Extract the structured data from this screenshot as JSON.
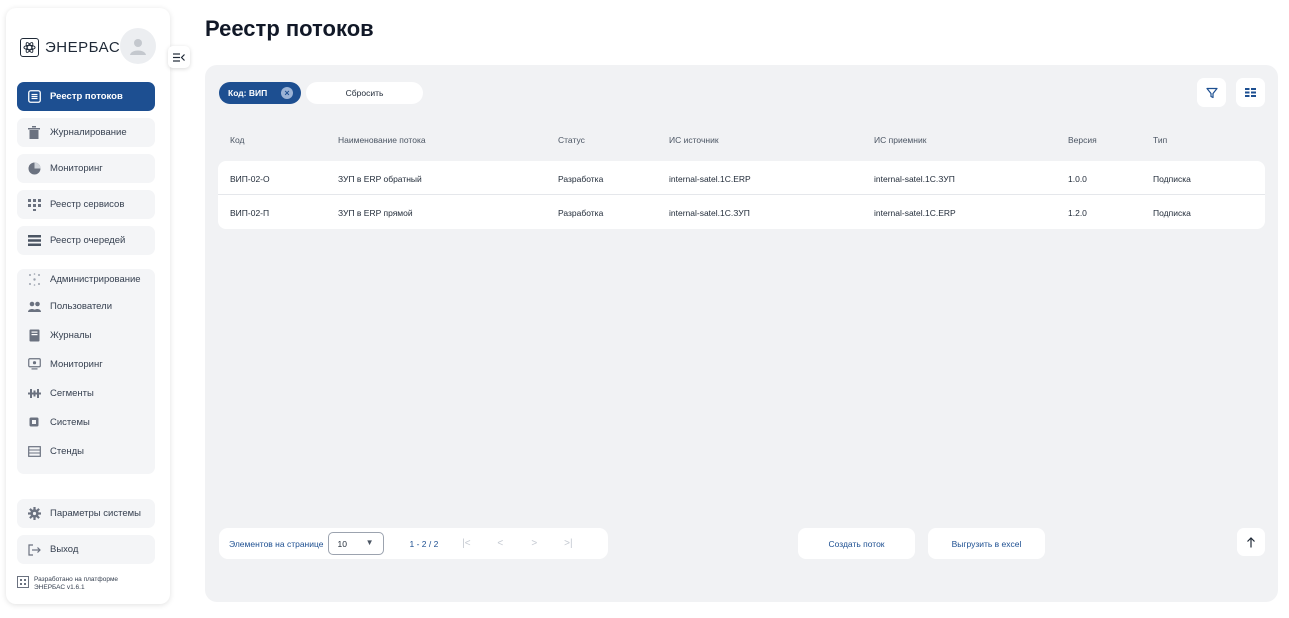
{
  "app": {
    "logo_text": "ЭНЕРБАС"
  },
  "sidebar": {
    "items": [
      {
        "label": "Реестр потоков",
        "icon": "list-icon",
        "active": true
      },
      {
        "label": "Журналирование",
        "icon": "trash-bin-icon"
      },
      {
        "label": "Мониторинг",
        "icon": "pie-chart-icon"
      },
      {
        "label": "Реестр сервисов",
        "icon": "grid-dots-icon"
      },
      {
        "label": "Реестр очередей",
        "icon": "stack-lines-icon"
      }
    ],
    "admin": {
      "label": "Администрирование",
      "icon": "sparkle-icon",
      "children": [
        {
          "label": "Пользователи",
          "icon": "users-icon"
        },
        {
          "label": "Журналы",
          "icon": "journal-icon"
        },
        {
          "label": "Мониторинг",
          "icon": "monitor-icon"
        },
        {
          "label": "Сегменты",
          "icon": "segments-icon"
        },
        {
          "label": "Системы",
          "icon": "chip-icon"
        },
        {
          "label": "Стенды",
          "icon": "stands-icon"
        }
      ]
    },
    "settings_label": "Параметры системы",
    "logout_label": "Выход",
    "footer_line1": "Разработано на платформе",
    "footer_line2": "ЭНЕРБАС v1.6.1"
  },
  "main": {
    "title": "Реестр потоков",
    "filter_chip": "Код: ВИП",
    "reset_label": "Сбросить",
    "table": {
      "columns": [
        "Код",
        "Наименование потока",
        "Статус",
        "ИС источник",
        "ИС приемник",
        "Версия",
        "Тип"
      ],
      "rows": [
        [
          "ВИП-02-О",
          "ЗУП в ERP обратный",
          "Разработка",
          "internal-satel.1C.ERP",
          "internal-satel.1C.ЗУП",
          "1.0.0",
          "Подписка"
        ],
        [
          "ВИП-02-П",
          "ЗУП в ERP прямой",
          "Разработка",
          "internal-satel.1C.ЗУП",
          "internal-satel.1C.ERP",
          "1.2.0",
          "Подписка"
        ]
      ]
    },
    "pager": {
      "label": "Элементов на странице",
      "page_size": "10",
      "range": "1 - 2 / 2",
      "first": "|<",
      "prev": "<",
      "next": ">",
      "last": ">|"
    },
    "create_label": "Создать поток",
    "export_label": "Выгрузить в excel"
  },
  "colors": {
    "accent": "#1d4f91",
    "panel": "#f1f2f4",
    "nav_bg": "#f4f5f7"
  }
}
